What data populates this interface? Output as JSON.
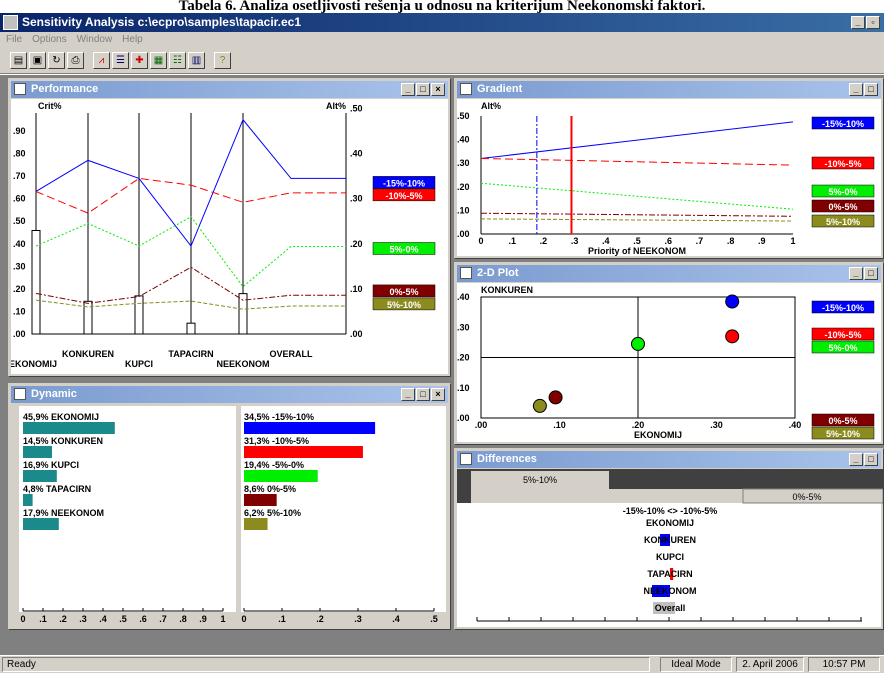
{
  "caption": "Tabela 6. Analiza osetljivosti rešenja u odnosu na kriterijum Neekonomski faktori.",
  "app": {
    "title": "Sensitivity Analysis  c:\\ecpro\\samples\\tapacir.ec1",
    "min_glyph": "_",
    "max_glyph": "▫"
  },
  "menu": [
    "File",
    "Options",
    "Window",
    "Help"
  ],
  "toolbar": [
    {
      "icon": "open-folder-icon"
    },
    {
      "icon": "save-icon"
    },
    {
      "icon": "refresh-icon"
    },
    {
      "icon": "print-icon"
    },
    {
      "icon": "performance-chart-icon"
    },
    {
      "icon": "dynamic-chart-icon"
    },
    {
      "icon": "gradient-chart-icon"
    },
    {
      "icon": "2d-plot-icon"
    },
    {
      "icon": "differences-icon"
    },
    {
      "icon": "window-icon"
    },
    {
      "icon": "help-icon"
    }
  ],
  "colors": {
    "blue": "#0000ff",
    "red": "#ff0000",
    "green": "#00ee00",
    "maroon": "#800000",
    "olive": "#8b8b1e",
    "teal": "#1b8a8a"
  },
  "alternatives": [
    {
      "name": "-15%-10%",
      "color": "#0000ff",
      "text": "#fff"
    },
    {
      "name": "-10%-5%",
      "color": "#ff0000",
      "text": "#fff"
    },
    {
      "name": "-5%-0%",
      "color": "#00ee00",
      "text": "#fff"
    },
    {
      "name": "0%-5%",
      "color": "#800000",
      "text": "#fff"
    },
    {
      "name": "5%-10%",
      "color": "#8b8b1e",
      "text": "#fff"
    }
  ],
  "performance": {
    "title": "Performance",
    "left_axis_label": "Crit%",
    "right_axis_label": "Alt%",
    "left_ticks": [
      ".00",
      ".10",
      ".20",
      ".30",
      ".40",
      ".50",
      ".60",
      ".70",
      ".80",
      ".90"
    ],
    "right_ticks": [
      ".00",
      ".10",
      ".20",
      ".30",
      ".40",
      ".50"
    ],
    "criteria_upper": [
      "KONKUREN",
      "TAPACIRN",
      "OVERALL"
    ],
    "criteria_lower": [
      "EKONOMIJ",
      "KUPCI",
      "NEEKONOM"
    ],
    "legend": [
      "-15%-10%",
      "-10%-5%",
      "5%-0%",
      "0%-5%",
      "5%-10%"
    ]
  },
  "chart_data": [
    {
      "type": "line",
      "title": "Performance",
      "x": [
        "EKONOMIJ",
        "KONKUREN",
        "KUPCI",
        "TAPACIRN",
        "NEEKONOM",
        "OVERALL"
      ],
      "crit_bars": [
        0.459,
        0.145,
        0.169,
        0.048,
        0.179
      ],
      "series": [
        {
          "name": "-15%-10%",
          "values": [
            0.316,
            0.385,
            0.345,
            0.195,
            0.475,
            0.345
          ]
        },
        {
          "name": "-10%-5%",
          "values": [
            0.316,
            0.268,
            0.345,
            0.33,
            0.292,
            0.313
          ]
        },
        {
          "name": "5%-0%",
          "values": [
            0.195,
            0.245,
            0.195,
            0.26,
            0.105,
            0.194
          ]
        },
        {
          "name": "0%-5%",
          "values": [
            0.09,
            0.068,
            0.083,
            0.148,
            0.075,
            0.086
          ]
        },
        {
          "name": "5%-10%",
          "values": [
            0.075,
            0.06,
            0.068,
            0.073,
            0.055,
            0.062
          ]
        }
      ]
    },
    {
      "type": "bar",
      "title": "Dynamic",
      "categories": [
        "EKONOMIJ",
        "KONKUREN",
        "KUPCI",
        "TAPACIRN",
        "NEEKONOM"
      ],
      "values": [
        0.459,
        0.145,
        0.169,
        0.048,
        0.179
      ],
      "ticks": [
        "0",
        ".1",
        ".2",
        ".3",
        ".4",
        ".5",
        ".6",
        ".7",
        ".8",
        ".9",
        "1"
      ]
    },
    {
      "type": "bar",
      "title": "Dynamic",
      "categories": [
        "-15%-10%",
        "-10%-5%",
        "-5%-0%",
        "0%-5%",
        "5%-10%"
      ],
      "values": [
        0.345,
        0.313,
        0.194,
        0.086,
        0.062
      ],
      "ticks": [
        "0",
        ".1",
        ".2",
        ".3",
        ".4",
        ".5"
      ]
    },
    {
      "type": "line",
      "title": "Gradient",
      "xlabel": "Priority of NEEKONOM",
      "ylabel": "Alt%",
      "xlim": [
        0,
        1
      ],
      "ylim": [
        0,
        0.5
      ],
      "current_x": 0.179,
      "series": [
        {
          "name": "-15%-10%",
          "values": [
            [
              0,
              0.32
            ],
            [
              1,
              0.475
            ]
          ]
        },
        {
          "name": "-10%-5%",
          "values": [
            [
              0,
              0.32
            ],
            [
              1,
              0.292
            ]
          ]
        },
        {
          "name": "-5%-0%",
          "values": [
            [
              0,
              0.215
            ],
            [
              1,
              0.105
            ]
          ]
        },
        {
          "name": "0%-5%",
          "values": [
            [
              0,
              0.088
            ],
            [
              1,
              0.075
            ]
          ]
        },
        {
          "name": "5%-10%",
          "values": [
            [
              0,
              0.064
            ],
            [
              1,
              0.055
            ]
          ]
        }
      ]
    },
    {
      "type": "scatter",
      "title": "2-D Plot",
      "xlabel": "EKONOMIJ",
      "ylabel": "KONKUREN",
      "xlim": [
        0,
        0.4
      ],
      "ylim": [
        0,
        0.4
      ],
      "series": [
        {
          "name": "-15%-10%",
          "values": [
            [
              0.32,
              0.385
            ]
          ]
        },
        {
          "name": "-10%-5%",
          "values": [
            [
              0.32,
              0.27
            ]
          ]
        },
        {
          "name": "-5%-0%",
          "values": [
            [
              0.2,
              0.245
            ]
          ]
        },
        {
          "name": "0%-5%",
          "values": [
            [
              0.095,
              0.068
            ]
          ]
        },
        {
          "name": "5%-10%",
          "values": [
            [
              0.075,
              0.04
            ]
          ]
        }
      ]
    }
  ],
  "dynamic": {
    "title": "Dynamic",
    "left_labels": [
      "45,9% EKONOMIJ",
      "14,5% KONKUREN",
      "16,9% KUPCI",
      "4,8% TAPACIRN",
      "17,9% NEEKONOM"
    ],
    "right_labels": [
      "34,5% -15%-10%",
      "31,3% -10%-5%",
      "19,4% -5%-0%",
      "8,6% 0%-5%",
      "6,2% 5%-10%"
    ]
  },
  "gradient": {
    "title": "Gradient",
    "ylabel": "Alt%",
    "xlabel": "Priority of NEEKONOM",
    "yticks": [
      ".00",
      ".10",
      ".20",
      ".30",
      ".40",
      ".50"
    ],
    "xticks": [
      "0",
      ".1",
      ".2",
      ".3",
      ".4",
      ".5",
      ".6",
      ".7",
      ".8",
      ".9",
      "1"
    ],
    "legend": [
      "-15%-10%",
      "-10%-5%",
      "5%-0%",
      "0%-5%",
      "5%-10%"
    ]
  },
  "plot2d": {
    "title": "2-D Plot",
    "ylabel": "KONKUREN",
    "xlabel": "EKONOMIJ",
    "yticks": [
      ".00",
      ".10",
      ".20",
      ".30",
      ".40"
    ],
    "xticks": [
      ".00",
      ".10",
      ".20",
      ".30",
      ".40"
    ],
    "legend": [
      "-15%-10%",
      "-10%-5%",
      "5%-0%",
      "0%-5%",
      "5%-10%"
    ]
  },
  "differences": {
    "title": "Differences",
    "tab_left": "5%-10%",
    "tab_right": "0%-5%",
    "heading": "-15%-10% <> -10%-5%",
    "rows": [
      "EKONOMIJ",
      "KONKUREN",
      "KUPCI",
      "TAPACIRN",
      "NEEKONOM",
      "Overall"
    ],
    "diffs": [
      0,
      -0.025,
      0,
      0.008,
      -0.045,
      -0.004
    ]
  },
  "status": {
    "text": "Ready",
    "mode": "Ideal Mode",
    "date": "2. April 2006",
    "time": "10:57 PM"
  }
}
